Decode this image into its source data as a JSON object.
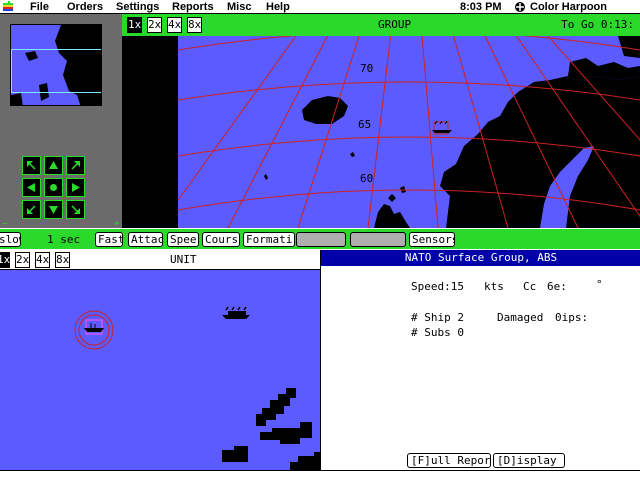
{
  "menubar": {
    "items": [
      "File",
      "Orders",
      "Settings",
      "Reports",
      "Misc",
      "Help"
    ],
    "clock": "8:03 PM",
    "app_name": "Color Harpoon DEMO",
    "icon": "apple-icon"
  },
  "group_window": {
    "title": "GROUP",
    "to_go": "To Go 0:13:",
    "zoom_levels": [
      "1x",
      "2x",
      "4x",
      "8x"
    ],
    "selected_zoom": "1x",
    "latitude_labels": [
      "70",
      "65",
      "60"
    ]
  },
  "command_bar": {
    "items": [
      "Slow",
      "1 sec",
      "Fast",
      "Attack",
      "Speed",
      "Course",
      "Formation",
      "",
      "",
      "Sensors"
    ],
    "display": [
      "slow",
      "1 sec",
      "Fast",
      "Attac",
      "Spee",
      "Cours",
      "Formati",
      "",
      "",
      "Sensors"
    ]
  },
  "unit_window": {
    "title": "UNIT",
    "zoom_levels": [
      "1x",
      "2x",
      "4x",
      "8x"
    ],
    "selected_zoom": "1x"
  },
  "info_panel": {
    "title": "NATO Surface Group, ABS",
    "speed_label": "Speed:15",
    "speed_unit": "kts",
    "course_label": "Cc",
    "course_value": "6e:",
    "degree_symbol": "°",
    "ships_label": "# Ship 2",
    "damaged_label": "Damaged",
    "damaged_value": "0ips:",
    "subs_label": "# Subs 0",
    "full_report_button": "[F]ull Report",
    "display_button": "[D]isplay"
  },
  "colors": {
    "sea": "#5b5bff",
    "ui_green": "#2bd92b",
    "title_blue": "#0000a8",
    "grid_red": "#cc2222",
    "panel_grey": "#6b6b6b"
  }
}
